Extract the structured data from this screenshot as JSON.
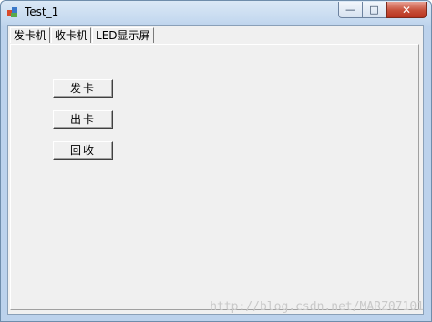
{
  "window": {
    "title": "Test_1",
    "caption_buttons": {
      "minimize": "—",
      "maximize": "□",
      "close": "✕"
    }
  },
  "tabs": [
    {
      "label": "发卡机",
      "active": true
    },
    {
      "label": "收卡机",
      "active": false
    },
    {
      "label": "LED显示屏",
      "active": false
    }
  ],
  "buttons": {
    "issue_card": "发卡",
    "card_out": "出卡",
    "recycle": "回收"
  },
  "watermark": "http://blog.csdn.net/MARZ07101"
}
